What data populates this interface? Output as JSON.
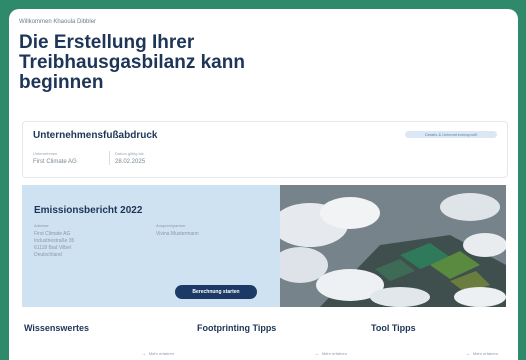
{
  "welcome": "Willkommen Khaoula Dibbler",
  "headline": "Die Erstellung Ihrer Treibhausgasbilanz kann beginnen",
  "footprint": {
    "title": "Unternehmensfußabdruck",
    "action_label": "Details & Unternehmensprofil",
    "company_label": "Unternehmen",
    "company_value": "First Climate AG",
    "date_label": "Datum gültig bis",
    "date_value": "28.02.2025"
  },
  "report": {
    "title": "Emissionsbericht 2022",
    "address_label": "Adresse",
    "address_line1": "First Climate AG",
    "address_line2": "Industriestraße 35",
    "address_line3": "61118 Bad Vilbel",
    "address_line4": "Deutschland",
    "contact_label": "Ansprechpartner",
    "contact_value": "Vivina Mustermann",
    "button_label": "Berechnung starten"
  },
  "tips": [
    {
      "title": "Wissenswertes",
      "link": "Mehr erfahren"
    },
    {
      "title": "Footprinting Tipps",
      "link": "Mehr erfahren"
    },
    {
      "title": "Tool Tipps",
      "link": "Mehr erfahren"
    }
  ],
  "colors": {
    "background": "#2f8a6b",
    "primary": "#1d3557",
    "panel": "#cfe2f1",
    "button": "#1d3a66"
  }
}
